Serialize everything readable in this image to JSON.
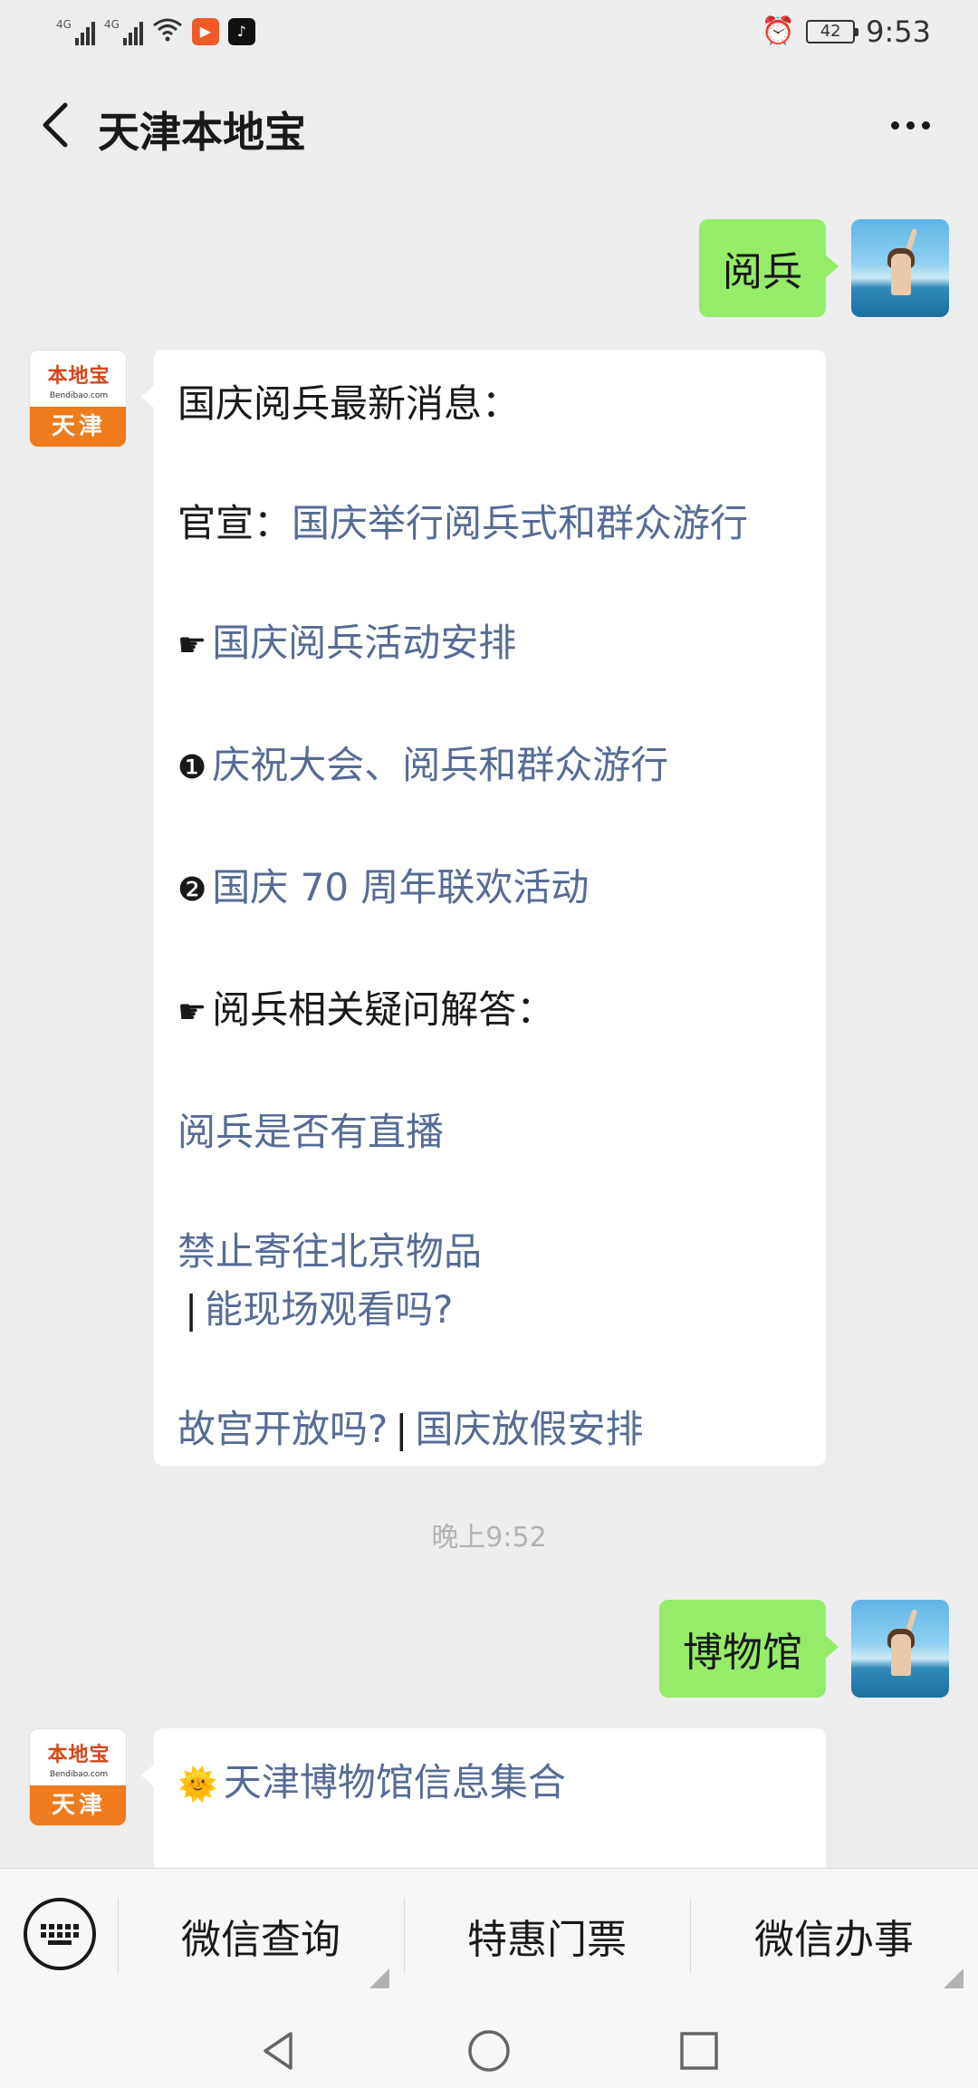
{
  "status_bar": {
    "network_1": "4G",
    "network_2": "4G",
    "battery_level": "42",
    "time": "9:53",
    "icons": [
      "signal-icon",
      "wifi-icon",
      "video-app-icon",
      "tiktok-icon",
      "alarm-icon",
      "battery-icon"
    ]
  },
  "header": {
    "title": "天津本地宝",
    "back_icon": "chevron-left-icon",
    "more_icon": "more-dots-icon"
  },
  "bot": {
    "logo_name": "本地宝",
    "logo_url": "Bendibao.com",
    "logo_city": "天津"
  },
  "messages": {
    "m1": {
      "text": "阅兵"
    },
    "m2": {
      "title": "国庆阅兵最新消息：",
      "official_prefix": "官宣：",
      "official_link": "国庆举行阅兵式和群众游行",
      "pointer_glyph": "☛",
      "arrangement_link": "国庆阅兵活动安排",
      "num1_glyph": "❶",
      "item1_link": "庆祝大会、阅兵和群众游行",
      "num2_glyph": "❷",
      "item2_link": "国庆 70 周年联欢活动",
      "pointer_glyph_2": "☛",
      "faq_heading": "阅兵相关疑问解答：",
      "faq1_link": "阅兵是否有直播",
      "faq2_link": "禁止寄往北京物品",
      "separator": "|",
      "faq3_link": "能现场观看吗?",
      "faq4_link": "故宫开放吗?",
      "separator_2": "|",
      "faq5_link": "国庆放假安排"
    },
    "timestamp": "晚上9:52",
    "m3": {
      "text": "博物馆"
    },
    "m4": {
      "sun_glyph": "🌞",
      "title_link": "天津博物馆信息集合"
    }
  },
  "menu": {
    "keyboard_icon": "keyboard-icon",
    "items": [
      "微信查询",
      "特惠门票",
      "微信办事"
    ]
  },
  "nav": {
    "icons": [
      "back-triangle-icon",
      "home-circle-icon",
      "recents-square-icon"
    ]
  },
  "colors": {
    "background": "#ededed",
    "user_bubble": "#95ec69",
    "bot_bubble": "#ffffff",
    "link": "#576b95",
    "logo_orange": "#ee7b1e"
  }
}
